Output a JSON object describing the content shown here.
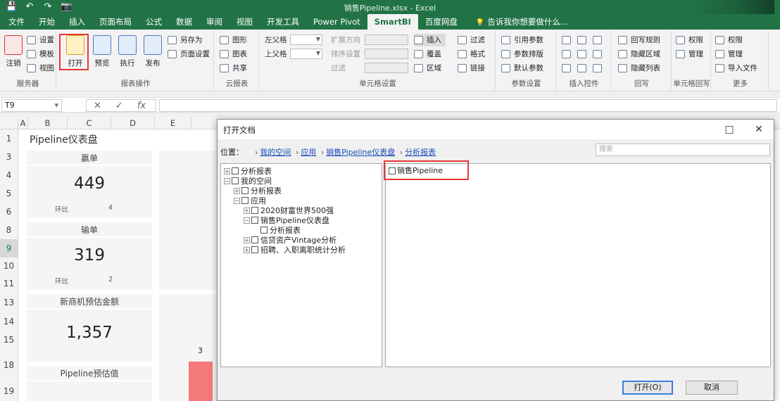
{
  "window": {
    "qat_icons": [
      "save-icon",
      "undo-icon",
      "redo-icon",
      "camera-icon"
    ],
    "title": "销售Pipeline.xlsx - Excel"
  },
  "tabs": [
    "文件",
    "开始",
    "插入",
    "页面布局",
    "公式",
    "数据",
    "审阅",
    "视图",
    "开发工具",
    "Power Pivot",
    "SmartBI",
    "百度网盘",
    "告诉我你想要做什么..."
  ],
  "active_tab": "SmartBI",
  "ribbon": {
    "server": {
      "logout": "注销",
      "settings": "设置",
      "template": "模板",
      "view": "视图",
      "label": "服务器"
    },
    "report_ops": {
      "open": "打开",
      "preview": "预览",
      "execute": "执行",
      "publish": "发布",
      "save": "另存为",
      "page_setup": "页面设置",
      "label": "报表操作"
    },
    "cloud": {
      "items": [
        "图形",
        "图表",
        "共享"
      ],
      "label": "云报表"
    },
    "report_settings": {
      "left_parent": "左父格",
      "top_parent": "上父格",
      "expand_dir": "扩展方向",
      "sort_set": "排序设置",
      "filter": "过滤",
      "insert": "插入",
      "cover": "覆盖",
      "area": "区域",
      "label": "单元格设置"
    },
    "param_settings": {
      "ref_param": "引用参数",
      "param_layout": "参数排版",
      "default_param": "默认参数",
      "label": "参数设置"
    },
    "insert_ctrl": {
      "items": [
        "过滤",
        "格式",
        "链接"
      ],
      "label": "插入控件"
    },
    "report_extra": {
      "layout": "回写规则",
      "hide_area": "隐藏区域",
      "hide_cols": "隐藏列表",
      "label": "回写"
    },
    "cell_rw": {
      "perm": "权限",
      "manage": "管理",
      "import": "导入文件",
      "label": "单元格回写"
    },
    "more": {
      "label": "更多"
    }
  },
  "formula_bar": {
    "cell_ref": "T9",
    "content": ""
  },
  "sheet": {
    "columns": [
      "A",
      "B",
      "C",
      "D",
      "E"
    ],
    "rows": [
      "1",
      "3",
      "4",
      "5",
      "6",
      "8",
      "9",
      "10",
      "11",
      "13",
      "14",
      "15",
      "18",
      "19"
    ],
    "title": "Pipeline仪表盘",
    "cards": [
      {
        "header": "赢单",
        "value": "449",
        "foot_label": "环比",
        "foot_value": "4"
      },
      {
        "header": "输单",
        "value": "319",
        "foot_label": "环比",
        "foot_value": "2"
      },
      {
        "header": "新商机预估金额",
        "value": "1,357",
        "foot_label": "",
        "foot_value": ""
      },
      {
        "header": "Pipeline预估值",
        "value": "",
        "foot_label": "",
        "foot_value": ""
      }
    ],
    "bar_label": "3"
  },
  "dialog": {
    "title": "打开文档",
    "location_label": "位置：",
    "crumbs": [
      "我的空间",
      "应用",
      "销售Pipeline仪表盘",
      "分析报表"
    ],
    "search_placeholder": "搜索",
    "tree": [
      {
        "label": "分析报表",
        "depth": 0,
        "toggle": "+"
      },
      {
        "label": "我的空间",
        "depth": 0,
        "toggle": "-"
      },
      {
        "label": "分析报表",
        "depth": 1,
        "toggle": "+"
      },
      {
        "label": "应用",
        "depth": 1,
        "toggle": "-"
      },
      {
        "label": "2020财富世界500强",
        "depth": 2,
        "toggle": "+"
      },
      {
        "label": "销售Pipeline仪表盘",
        "depth": 2,
        "toggle": "-"
      },
      {
        "label": "分析报表",
        "depth": 3,
        "toggle": ""
      },
      {
        "label": "信贷资产Vintage分析",
        "depth": 2,
        "toggle": "+"
      },
      {
        "label": "招聘、入职离职统计分析",
        "depth": 2,
        "toggle": "+"
      }
    ],
    "files": [
      "销售Pipeline"
    ],
    "ok": "打开(O)",
    "cancel": "取消",
    "maximize_icon": "□",
    "close_icon": "✕"
  }
}
